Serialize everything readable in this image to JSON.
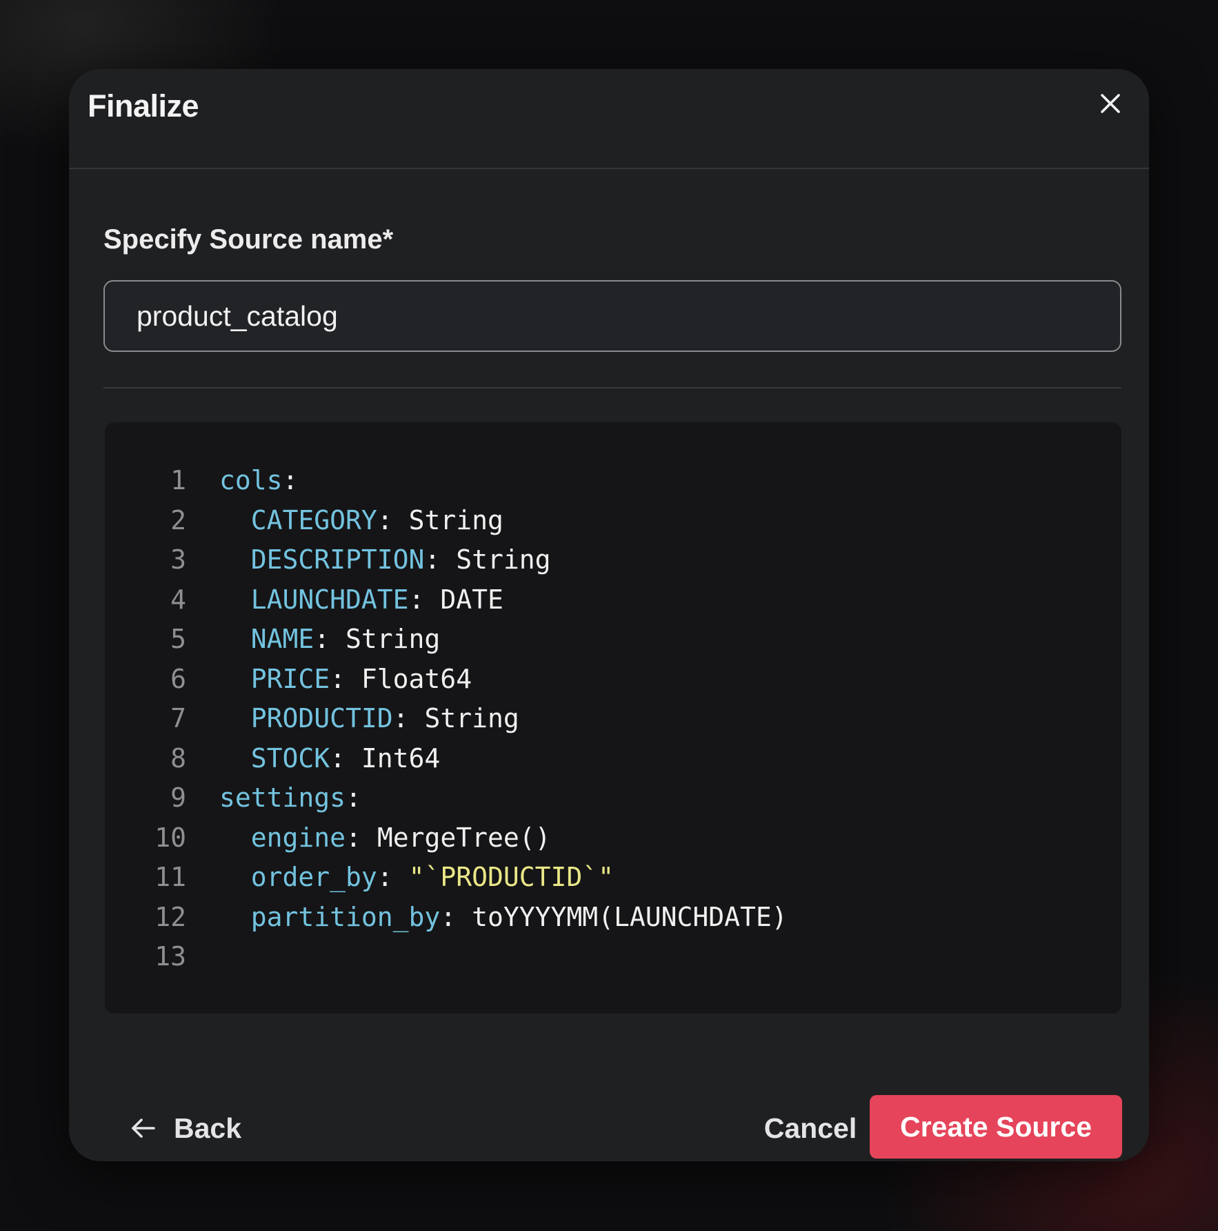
{
  "dialog": {
    "title": "Finalize",
    "close_icon": "close-icon"
  },
  "source_name": {
    "label": "Specify Source name*",
    "value": "product_catalog"
  },
  "code": {
    "lines": [
      {
        "num": "1",
        "indent": "",
        "key": "cols",
        "sep": ":",
        "value": "",
        "value_type": "plain"
      },
      {
        "num": "2",
        "indent": "  ",
        "key": "CATEGORY",
        "sep": ": ",
        "value": "String",
        "value_type": "plain"
      },
      {
        "num": "3",
        "indent": "  ",
        "key": "DESCRIPTION",
        "sep": ": ",
        "value": "String",
        "value_type": "plain"
      },
      {
        "num": "4",
        "indent": "  ",
        "key": "LAUNCHDATE",
        "sep": ": ",
        "value": "DATE",
        "value_type": "plain"
      },
      {
        "num": "5",
        "indent": "  ",
        "key": "NAME",
        "sep": ": ",
        "value": "String",
        "value_type": "plain"
      },
      {
        "num": "6",
        "indent": "  ",
        "key": "PRICE",
        "sep": ": ",
        "value": "Float64",
        "value_type": "plain"
      },
      {
        "num": "7",
        "indent": "  ",
        "key": "PRODUCTID",
        "sep": ": ",
        "value": "String",
        "value_type": "plain"
      },
      {
        "num": "8",
        "indent": "  ",
        "key": "STOCK",
        "sep": ": ",
        "value": "Int64",
        "value_type": "plain"
      },
      {
        "num": "9",
        "indent": "",
        "key": "settings",
        "sep": ":",
        "value": "",
        "value_type": "plain"
      },
      {
        "num": "10",
        "indent": "  ",
        "key": "engine",
        "sep": ": ",
        "value": "MergeTree()",
        "value_type": "plain"
      },
      {
        "num": "11",
        "indent": "  ",
        "key": "order_by",
        "sep": ": ",
        "value": "\"`PRODUCTID`\"",
        "value_type": "string"
      },
      {
        "num": "12",
        "indent": "  ",
        "key": "partition_by",
        "sep": ": ",
        "value": "toYYYYMM(LAUNCHDATE)",
        "value_type": "plain"
      },
      {
        "num": "13",
        "indent": "",
        "key": "",
        "sep": "",
        "value": "",
        "value_type": "plain"
      }
    ],
    "colors": {
      "key": "#73c3df",
      "string": "#e9e787",
      "plain": "#f0f0f0",
      "line_number": "#8e8f93"
    }
  },
  "footer": {
    "back_label": "Back",
    "back_icon": "arrow-left-icon",
    "cancel_label": "Cancel",
    "create_label": "Create Source",
    "accent": "#e5445a"
  }
}
